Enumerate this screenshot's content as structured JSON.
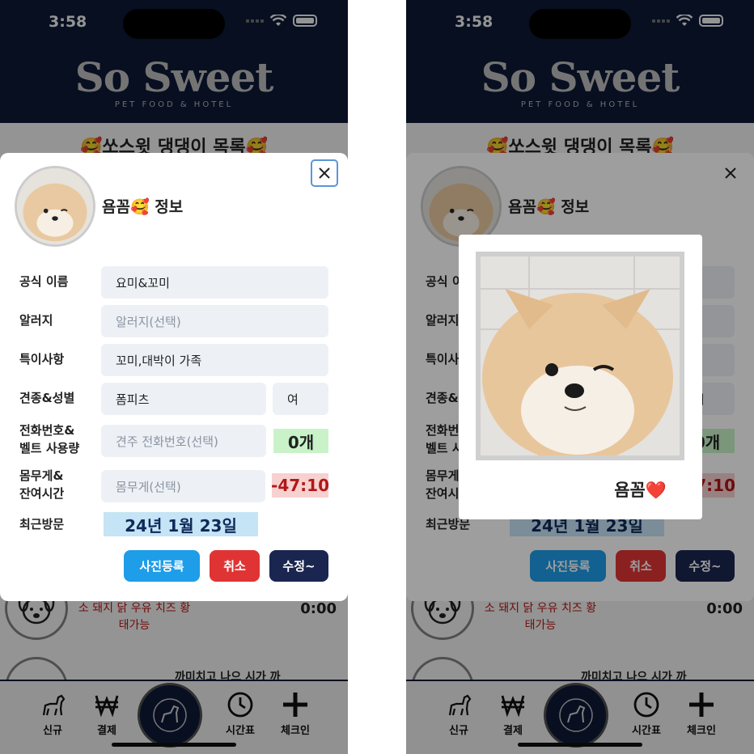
{
  "status": {
    "time": "3:58"
  },
  "header": {
    "brand": "So Sweet",
    "tagline": "PET FOOD & HOTEL"
  },
  "page": {
    "title": "🥰쏘스윗 댕댕이 목록🥰"
  },
  "list_row": {
    "note": "소 돼지 닭 우유 치즈 황태가능",
    "time": "0:00",
    "note2": "까미치고 나으 시가 까"
  },
  "modal": {
    "title": "욤꼼🥰 정보",
    "fields": {
      "official_name": {
        "label": "공식 이름",
        "value": "요미&꼬미"
      },
      "allergy": {
        "label": "알러지",
        "placeholder": "알러지(선택)"
      },
      "notes": {
        "label": "특이사항",
        "value": "꼬미,대박이 가족"
      },
      "breed_gender": {
        "label": "견종&성별",
        "breed": "폼피츠",
        "gender": "여"
      },
      "phone_belt": {
        "label_line1": "전화번호&",
        "label_line2": "벨트 사용량",
        "placeholder": "견주 전화번호(선택)",
        "belt_usage": "0개"
      },
      "weight_time": {
        "label_line1": "몸무게&",
        "label_line2": "잔여시간",
        "placeholder": "몸무게(선택)",
        "remaining": "-47:10"
      },
      "last_visit": {
        "label": "최근방문",
        "value": "24년 1월 23일"
      }
    },
    "buttons": {
      "photo": "사진등록",
      "cancel": "취소",
      "edit": "수정~"
    }
  },
  "photo_popup": {
    "caption": "욤꼼❤️"
  },
  "nav": {
    "new": "신규",
    "payment": "결제",
    "timetable": "시간표",
    "checkin": "체크인"
  },
  "colors": {
    "navy": "#0e1a3a",
    "blue_button": "#1e9de8",
    "red_button": "#e03434",
    "navy_button": "#1a2650"
  }
}
